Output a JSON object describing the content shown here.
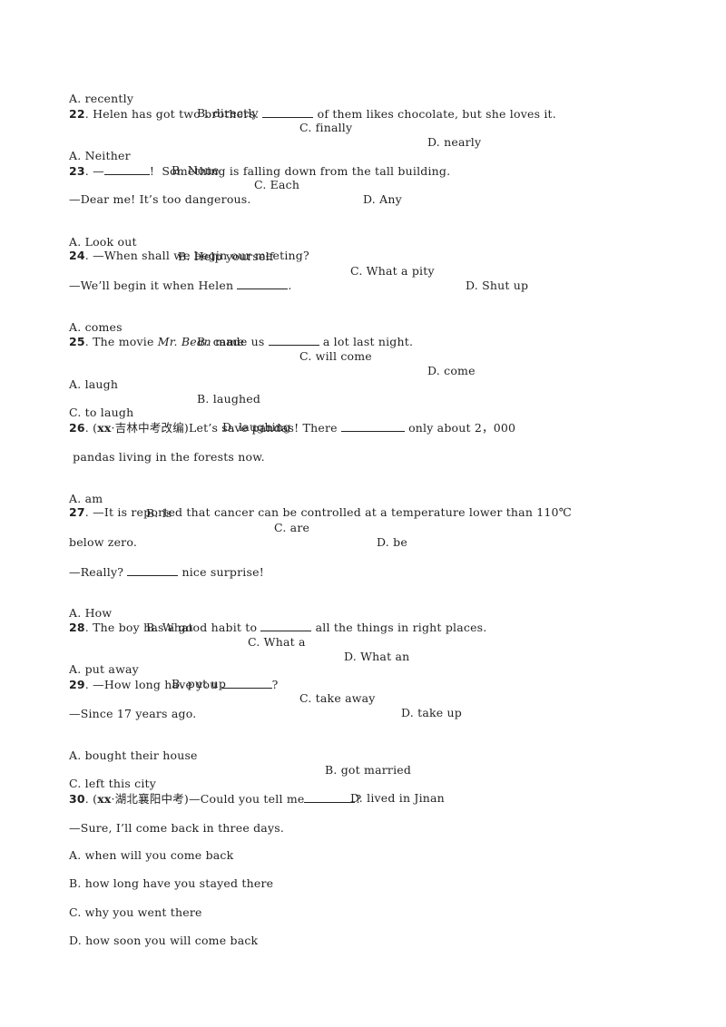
{
  "q21": {
    "options": [
      "A. recently",
      "B. directly",
      "C. finally",
      "D. nearly"
    ]
  },
  "q22": {
    "number": "22",
    "text_before": ". Helen has got two brothers. ",
    "text_after": " of them likes chocolate, but she loves it.",
    "options": [
      "A. Neither",
      "B. None",
      "C. Each",
      "D. Any"
    ]
  },
  "q23": {
    "number": "23",
    "text_before": ". —",
    "text_after": "!  Something is falling down from the tall building.",
    "reply": "—Dear me! It’s too dangerous.",
    "options": [
      "A. Look out",
      "B. Help yourself",
      "C. What a pity",
      "D. Shut up"
    ]
  },
  "q24": {
    "number": "24",
    "text": ". —When shall we begin our meeting?",
    "reply_before": "—We’ll begin it when Helen ",
    "reply_after": ".",
    "options": [
      "A. comes",
      "B. came",
      "C. will come",
      "D. come"
    ]
  },
  "q25": {
    "number": "25",
    "text_before": ". The movie ",
    "title_italic": "Mr. Bean",
    "text_mid": " made us ",
    "text_after": " a lot last night.",
    "options": [
      "A. laugh",
      "B. laughed",
      "C. to laugh",
      "D. laughing"
    ]
  },
  "q26": {
    "number": "26",
    "source_prefix": ". (",
    "source_year": "xx",
    "source_text": "·吉林中考改编)",
    "text_before": "Let’s save pandas! There ",
    "text_after": " only about 2，000",
    "text_cont": " pandas living in the forests now.",
    "options": [
      "A. am",
      "B. is",
      "C. are",
      "D. be"
    ]
  },
  "q27": {
    "number": "27",
    "text": ". —It is reported that cancer can be controlled at a temperature lower than 110℃",
    "text_cont": "below zero.",
    "reply_before": "—Really? ",
    "reply_after": " nice surprise!",
    "options": [
      "A. How",
      "B. What",
      "C. What a",
      "D. What an"
    ]
  },
  "q28": {
    "number": "28",
    "text_before": ". The boy has a good habit to ",
    "text_after": " all the things in right places.",
    "options": [
      "A. put away",
      "B. put up",
      "C. take away",
      "D. take up"
    ]
  },
  "q29": {
    "number": "29",
    "text_before": ". —How long have you ",
    "text_after": "?",
    "reply": "—Since 17 years ago.",
    "options": [
      "A. bought their house",
      "B. got married",
      "C. left this city",
      "D. lived in Jinan"
    ]
  },
  "q30": {
    "number": "30",
    "source_prefix": ". (",
    "source_year": "xx",
    "source_text": "·湖北襄阳中考)",
    "text_before": "—Could you tell me",
    "text_after": "?",
    "reply": "—Sure, I’ll come back in three days.",
    "options": [
      "A. when will you come back",
      "B. how long have you stayed there",
      "C. why you went there",
      "D. how soon you will come back"
    ]
  }
}
